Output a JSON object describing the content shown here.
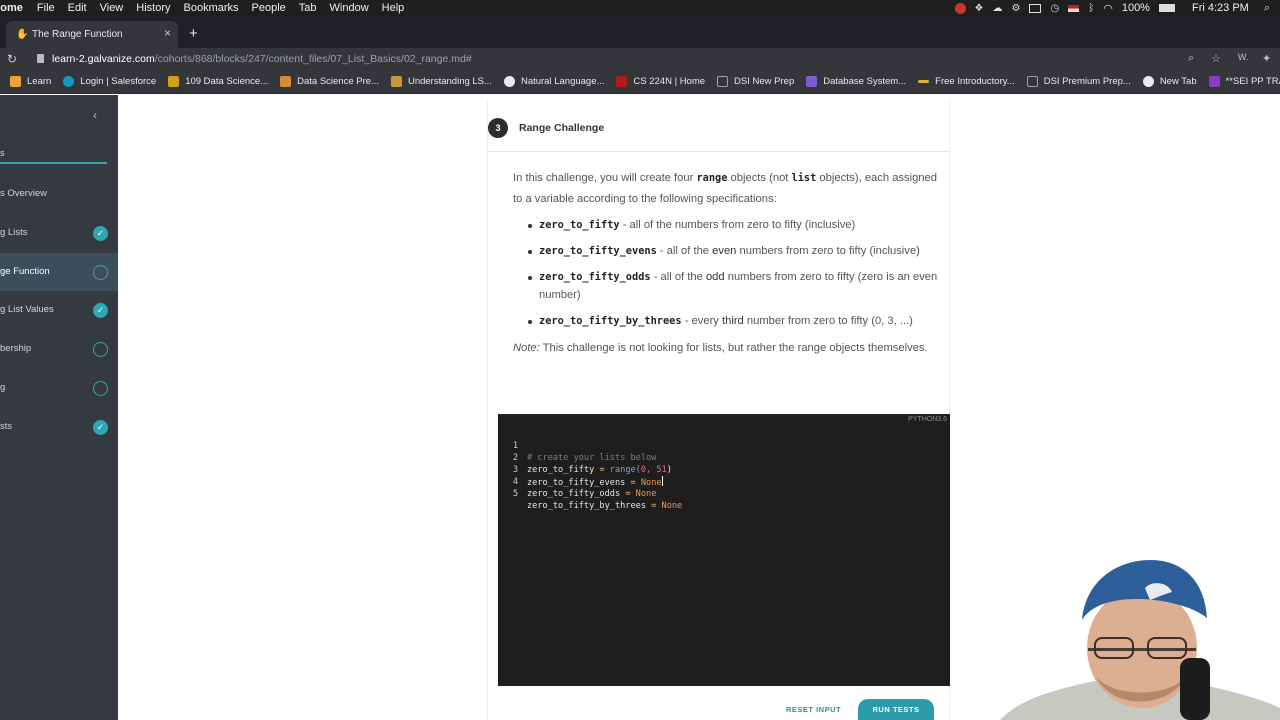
{
  "menubar": {
    "app": "rome",
    "items": [
      "File",
      "Edit",
      "View",
      "History",
      "Bookmarks",
      "People",
      "Tab",
      "Window",
      "Help"
    ],
    "battery": "100%",
    "clock": "Fri 4:23 PM"
  },
  "tab": {
    "title": "The Range Function",
    "close": "×",
    "new_tab": "+"
  },
  "address": {
    "url_host": "learn-2.galvanize.com",
    "url_path": "/cohorts/868/blocks/247/content_files/07_List_Basics/02_range.md#"
  },
  "bookmarks": [
    {
      "label": "Learn",
      "color": "#f0a030"
    },
    {
      "label": "Login | Salesforce",
      "color": "#1798c1"
    },
    {
      "label": "109 Data Science...",
      "color": "#d4a017"
    },
    {
      "label": "Data Science Pre...",
      "color": "#d8893a"
    },
    {
      "label": "Understanding LS...",
      "color": "#c49a3c"
    },
    {
      "label": "Natural Language...",
      "color": "#e8eaed"
    },
    {
      "label": "CS 224N | Home",
      "color": "#b31b1b"
    },
    {
      "label": "DSI New Prep",
      "color": "#a0a0a0"
    },
    {
      "label": "Database System...",
      "color": "#7b5cd6"
    },
    {
      "label": "Free Introductory...",
      "color": "#e0b040"
    },
    {
      "label": "DSI Premium Prep...",
      "color": "#a0a0a0"
    },
    {
      "label": "New Tab",
      "color": "#e8eaed"
    },
    {
      "label": "**SEI PP TRANSF...",
      "color": "#8c3cc8"
    }
  ],
  "sidebar": {
    "header": "s",
    "items": [
      {
        "label": "s Overview",
        "status": "none"
      },
      {
        "label": "g Lists",
        "status": "done"
      },
      {
        "label": "ge Function",
        "status": "active"
      },
      {
        "label": "g List Values",
        "status": "done"
      },
      {
        "label": "bership",
        "status": "todo"
      },
      {
        "label": "g",
        "status": "todo"
      },
      {
        "label": "sts",
        "status": "done"
      }
    ]
  },
  "challenge": {
    "number": "3",
    "title": "Range Challenge",
    "intro_1": "In this challenge, you will create four ",
    "intro_code_1": "range",
    "intro_2": " objects (not ",
    "intro_code_2": "list",
    "intro_3": " objects), each assigned to a variable according to the following specifications:",
    "specs": [
      {
        "code": "zero_to_fifty",
        "pre": " - all of the numbers from zero to fifty (inclusive)",
        "bold": "",
        "post": ""
      },
      {
        "code": "zero_to_fifty_evens",
        "pre": " - all of the ",
        "bold": "even",
        "post": " numbers from zero to fifty (inclusive)"
      },
      {
        "code": "zero_to_fifty_odds",
        "pre": " - all of the ",
        "bold": "odd",
        "post": " numbers from zero to fifty (zero is an even number)"
      },
      {
        "code": "zero_to_fifty_by_threes",
        "pre": " - every ",
        "bold": "third",
        "post": " number from zero to fifty (0, 3, ...)"
      }
    ],
    "note_label": "Note:",
    "note_text": " This challenge is not looking for lists, but rather the range objects themselves."
  },
  "editor": {
    "language": "PYTHON3.6",
    "line_numbers": [
      "1",
      "2",
      "3",
      "4",
      "5"
    ],
    "line1": "# create your lists below",
    "line2_var": "zero_to_fifty",
    "line2_eq": " = ",
    "line2_fn": "range(",
    "line2_args": "0, 51",
    "line2_close": ")",
    "line3_var": "zero_to_fifty_evens",
    "line4_var": "zero_to_fifty_odds",
    "line5_var": "zero_to_fifty_by_threes",
    "eq": " = ",
    "none": "None"
  },
  "actions": {
    "reset": "RESET INPUT",
    "run": "RUN TESTS"
  }
}
